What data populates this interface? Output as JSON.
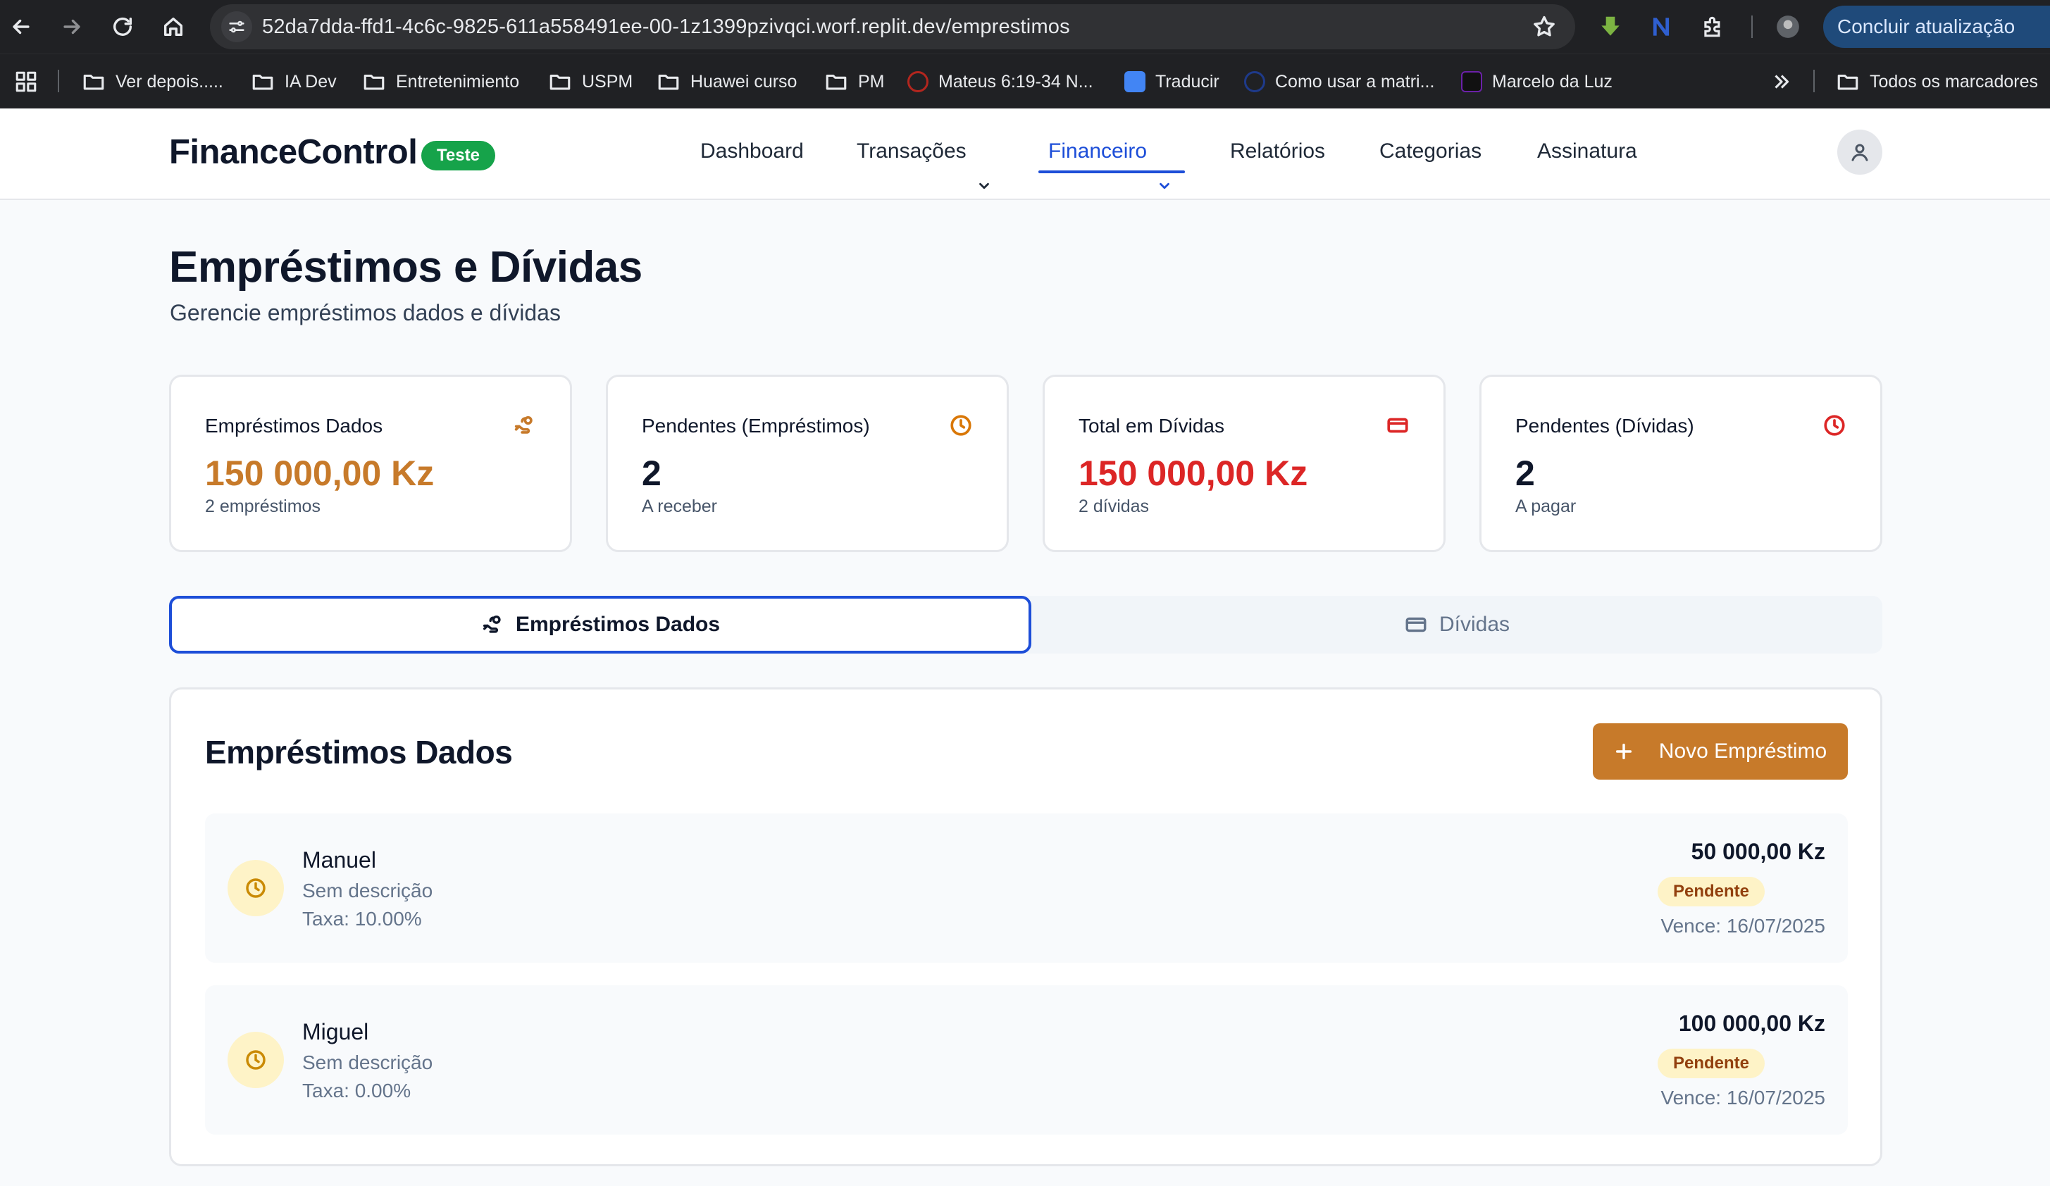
{
  "browser": {
    "url": "52da7dda-ffd1-4c6c-9825-611a558491ee-00-1z1399pzivqci.worf.replit.dev/emprestimos",
    "update_button": "Concluir atualização",
    "bookmarks": [
      {
        "label": "Ver depois.....",
        "icon": "folder-icon"
      },
      {
        "label": "IA Dev",
        "icon": "folder-icon"
      },
      {
        "label": "Entretenimiento",
        "icon": "folder-icon"
      },
      {
        "label": "USPM",
        "icon": "folder-icon"
      },
      {
        "label": "Huawei curso",
        "icon": "folder-icon"
      },
      {
        "label": "PM",
        "icon": "folder-icon"
      },
      {
        "label": "Mateus 6:19-34 N...",
        "icon": "site-icon"
      },
      {
        "label": "Traducir",
        "icon": "translate-icon"
      },
      {
        "label": "Como usar a matri...",
        "icon": "site-icon"
      },
      {
        "label": "Marcelo da Luz",
        "icon": "site-icon"
      }
    ],
    "all_bookmarks": "Todos os marcadores"
  },
  "header": {
    "brand": "FinanceControl",
    "badge": "Teste",
    "nav": {
      "dashboard": "Dashboard",
      "transacoes": "Transações",
      "financeiro": "Financeiro",
      "relatorios": "Relatórios",
      "categorias": "Categorias",
      "assinatura": "Assinatura"
    },
    "active_nav": "Financeiro"
  },
  "page": {
    "title": "Empréstimos e Dívidas",
    "subtitle": "Gerencie empréstimos dados e dívidas"
  },
  "stats": [
    {
      "label": "Empréstimos Dados",
      "value": "150 000,00 Kz",
      "sub": "2 empréstimos",
      "icon": "hand-coins-icon",
      "color": "#c77a2a"
    },
    {
      "label": "Pendentes (Empréstimos)",
      "value": "2",
      "sub": "A receber",
      "icon": "clock-icon",
      "color": "#0f172a"
    },
    {
      "label": "Total em Dívidas",
      "value": "150 000,00 Kz",
      "sub": "2 dívidas",
      "icon": "credit-card-icon",
      "color": "#dc2626"
    },
    {
      "label": "Pendentes (Dívidas)",
      "value": "2",
      "sub": "A pagar",
      "icon": "clock-icon",
      "color": "#0f172a"
    }
  ],
  "tabs": {
    "loans": "Empréstimos Dados",
    "debts": "Dívidas",
    "active": "loans"
  },
  "panel": {
    "title": "Empréstimos Dados",
    "new_button": "Novo Empréstimo",
    "loans": [
      {
        "name": "Manuel",
        "description": "Sem descrição",
        "rate": "Taxa: 10.00%",
        "amount": "50 000,00 Kz",
        "status": "Pendente",
        "due": "Vence: 16/07/2025"
      },
      {
        "name": "Miguel",
        "description": "Sem descrição",
        "rate": "Taxa: 0.00%",
        "amount": "100 000,00 Kz",
        "status": "Pendente",
        "due": "Vence: 16/07/2025"
      }
    ]
  },
  "colors": {
    "accent_orange": "#c77a2a",
    "accent_blue": "#1d4ed8",
    "danger_red": "#dc2626",
    "badge_green": "#16a34a",
    "pending_bg": "#fef3c7"
  }
}
